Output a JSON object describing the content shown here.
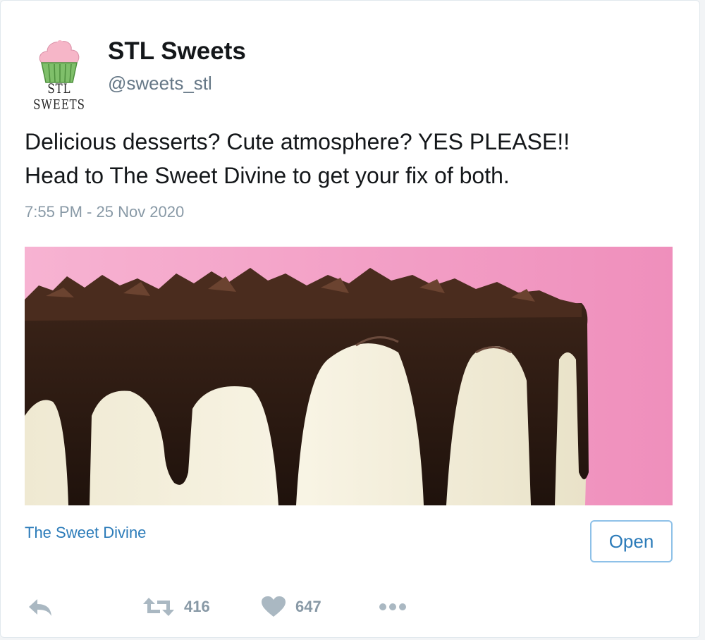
{
  "account": {
    "avatar_text": "STL SWEETS",
    "display_name": "STL Sweets",
    "handle": "@sweets_stl"
  },
  "tweet": {
    "text_line1": "Delicious desserts? Cute atmosphere? YES PLEASE!!",
    "text_line2": "Head to The Sweet Divine to get your fix of both.",
    "timestamp": "7:55 PM - 25 Nov 2020"
  },
  "card": {
    "link_title": "The Sweet Divine",
    "open_label": "Open"
  },
  "actions": {
    "reply_icon": "reply-icon",
    "retweet_icon": "retweet-icon",
    "retweet_count": "416",
    "like_icon": "heart-icon",
    "like_count": "647",
    "more_icon": "more-icon"
  },
  "colors": {
    "link": "#2b7bb9",
    "muted": "#8899a6",
    "media_background": "#f5a8cd"
  }
}
